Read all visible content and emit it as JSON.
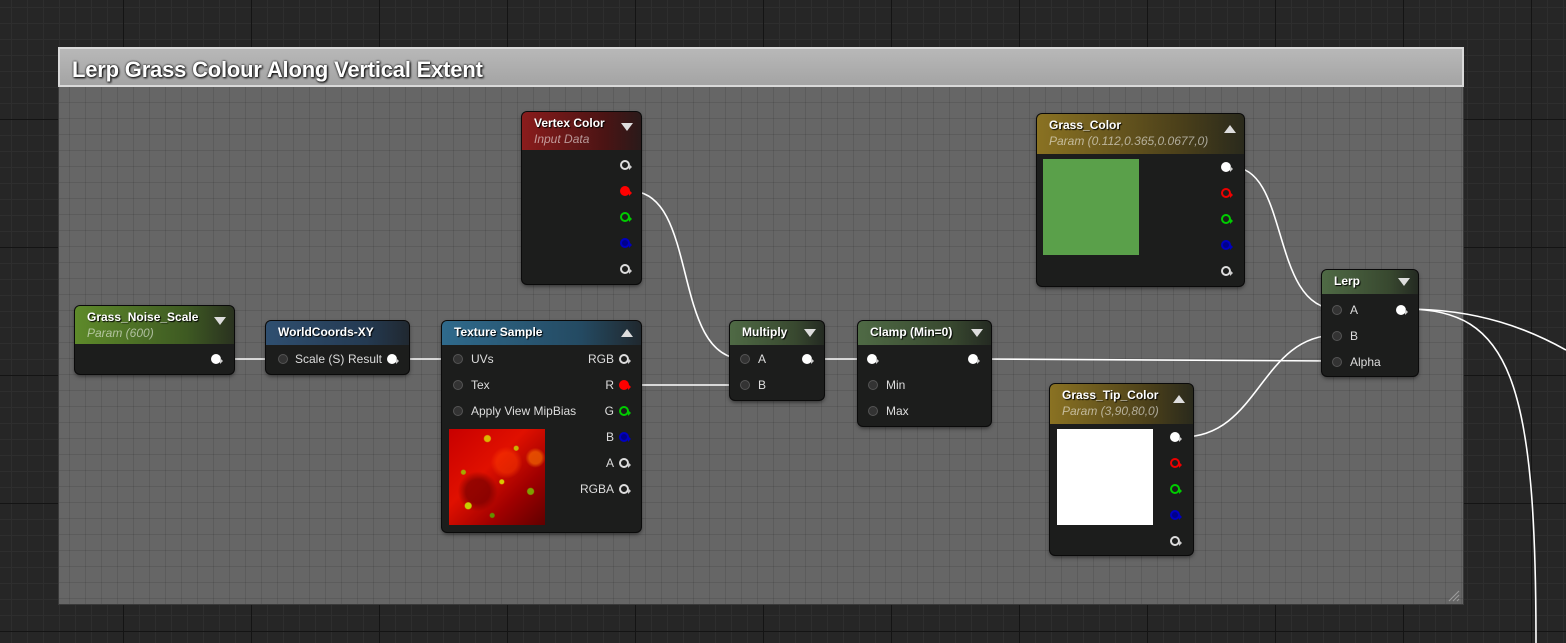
{
  "comment": {
    "title": "Lerp Grass Colour Along Vertical Extent"
  },
  "nodes": {
    "vertex_color": {
      "title": "Vertex Color",
      "subtitle": "Input Data"
    },
    "grass_color": {
      "title": "Grass_Color",
      "subtitle": "Param (0.112,0.365,0.0677,0)",
      "swatch_color": "#5aa04a"
    },
    "noise_scale": {
      "title": "Grass_Noise_Scale",
      "subtitle": "Param (600)"
    },
    "worldcoords": {
      "title": "WorldCoords-XY",
      "in_label": "Scale (S)",
      "out_label": "Result"
    },
    "texture_sample": {
      "title": "Texture Sample",
      "inputs": [
        "UVs",
        "Tex",
        "Apply View MipBias"
      ],
      "outputs": [
        "RGB",
        "R",
        "G",
        "B",
        "A",
        "RGBA"
      ]
    },
    "multiply": {
      "title": "Multiply",
      "inputs": [
        "A",
        "B"
      ]
    },
    "clamp": {
      "title": "Clamp (Min=0)",
      "inputs": [
        "Min",
        "Max"
      ]
    },
    "grass_tip_color": {
      "title": "Grass_Tip_Color",
      "subtitle": "Param (3,90,80,0)",
      "swatch_color": "#ffffff"
    },
    "lerp": {
      "title": "Lerp",
      "inputs": [
        "A",
        "B",
        "Alpha"
      ]
    }
  },
  "colors": {
    "param_header": "#5d7a2a",
    "function_header": "#2f4f6f",
    "vertex_header": "#7a1a1a",
    "vector_param_header": "#7a6520",
    "math_header": "#4f6a45",
    "wire": "#ffffff"
  }
}
